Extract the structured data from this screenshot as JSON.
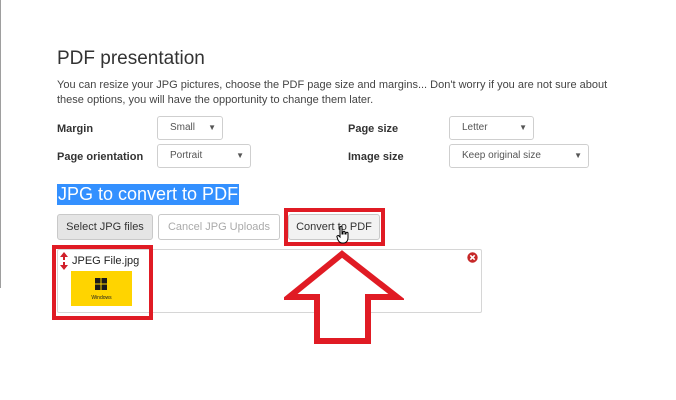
{
  "section": {
    "title": "PDF presentation",
    "description": "You can resize your JPG pictures, choose the PDF page size and margins... Don't worry if you are not sure about these options, you will have the opportunity to change them later."
  },
  "options": {
    "margin": {
      "label": "Margin",
      "value": "Small"
    },
    "page_size": {
      "label": "Page size",
      "value": "Letter"
    },
    "page_orientation": {
      "label": "Page orientation",
      "value": "Portrait"
    },
    "image_size": {
      "label": "Image size",
      "value": "Keep original size"
    }
  },
  "upload": {
    "title": "JPG to convert to PDF",
    "select_label": "Select JPG files",
    "cancel_label": "Cancel JPG Uploads",
    "convert_label": "Convert to PDF"
  },
  "file": {
    "name": "JPEG File.jpg",
    "thumb_caption": "Windows"
  },
  "colors": {
    "highlight": "#3390ff",
    "annotation_red": "#e01b24",
    "thumbnail_yellow": "#ffd400"
  }
}
